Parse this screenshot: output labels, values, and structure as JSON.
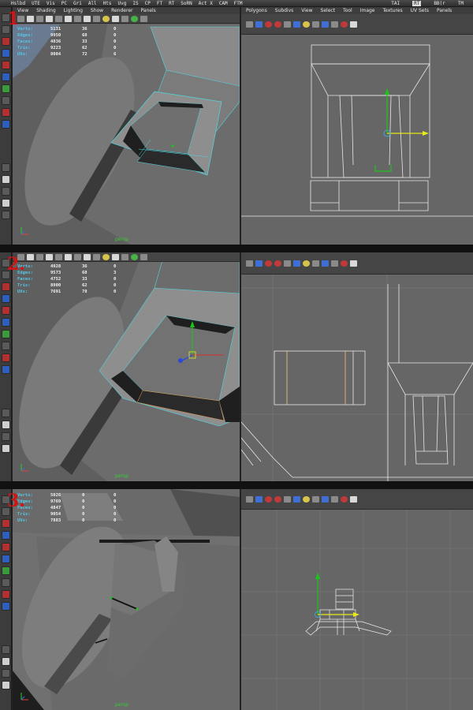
{
  "shelf": {
    "items": [
      "Hslbd",
      "UTE",
      "Vis",
      "PC",
      "Gri",
      "All",
      "Hts",
      "Uvg",
      "IS",
      "CP",
      "FT",
      "RT",
      "SoRN",
      "Act X",
      "CAM",
      "FTM"
    ],
    "right": [
      "TAI",
      "RT",
      "BB(r",
      "TM"
    ]
  },
  "steps": [
    "1",
    "2.",
    "3."
  ],
  "viewport_menu_left": [
    "View",
    "Shading",
    "Lighting",
    "Show",
    "Renderer",
    "Panels"
  ],
  "viewport_menu_right": [
    "Polygons",
    "Subdivs",
    "View",
    "Select",
    "Tool",
    "Image",
    "Textures",
    "UV Sets",
    "Panels"
  ],
  "hud_labels": [
    "Verts:",
    "Edges:",
    "Faces:",
    "Tris:",
    "UVs:"
  ],
  "hud": {
    "p1": [
      [
        "5131",
        "36",
        "0"
      ],
      [
        "9950",
        "68",
        "0"
      ],
      [
        "4836",
        "33",
        "0"
      ],
      [
        "9223",
        "62",
        "0"
      ],
      [
        "8004",
        "72",
        "6"
      ]
    ],
    "p2": [
      [
        "4928",
        "36",
        "0"
      ],
      [
        "9573",
        "68",
        "3"
      ],
      [
        "4752",
        "33",
        "0"
      ],
      [
        "8900",
        "62",
        "0"
      ],
      [
        "7691",
        "78",
        "0"
      ]
    ],
    "p3": [
      [
        "5026",
        "0",
        "0"
      ],
      [
        "9769",
        "0",
        "0"
      ],
      [
        "4847",
        "0",
        "0"
      ],
      [
        "9054",
        "0",
        "0"
      ],
      [
        "7883",
        "0",
        "0"
      ]
    ]
  },
  "camera_label": "persp",
  "colors": {
    "hud_label": "#58c6e6",
    "wire_selected": "#4fd6e0",
    "step_number": "#d01515",
    "manip_x": "#e8e81a",
    "manip_y": "#19c619",
    "manip_z": "#2a4ad8"
  }
}
